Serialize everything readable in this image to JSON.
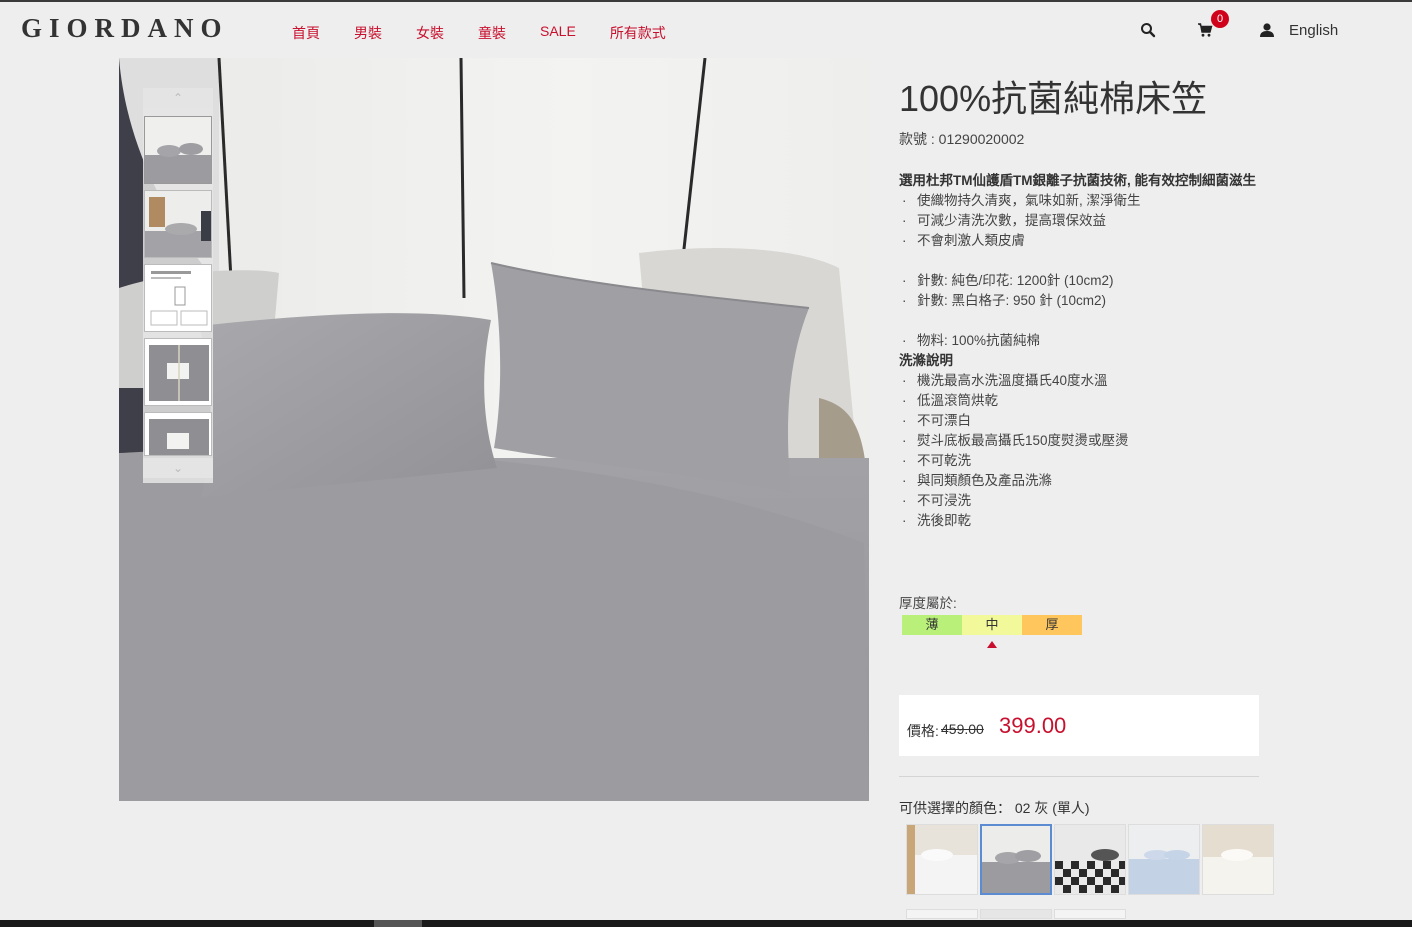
{
  "header": {
    "logo": "GIORDANO",
    "nav": [
      "首頁",
      "男裝",
      "女裝",
      "童裝",
      "SALE",
      "所有款式"
    ],
    "cart_count": "0",
    "language": "English"
  },
  "product": {
    "title": "100%抗菌純棉床笠",
    "sku": "款號 : 01290020002",
    "intro": "選用杜邦TM仙護盾TM銀離子抗菌技術, 能有效控制細菌滋生",
    "features": [
      "使織物持久清爽，氣味如新, 潔淨衛生",
      "可減少清洗次數，提高環保效益",
      "不會刺激人類皮膚"
    ],
    "thread_counts": [
      "針數: 純色/印花: 1200針 (10cm2)",
      "針數: 黑白格子: 950 針 (10cm2)"
    ],
    "material": "物料: 100%抗菌純棉",
    "wash_title": "洗滌說明",
    "wash": [
      "機洗最高水洗溫度攝氏40度水溫",
      "低溫滾筒烘乾",
      "不可漂白",
      "熨斗底板最高攝氏150度熨燙或壓燙",
      "不可乾洗",
      "與同類顏色及產品洗滌",
      "不可浸洗",
      "洗後即乾"
    ],
    "thickness_label": "厚度屬於:",
    "thickness_levels": [
      "薄",
      "中",
      "厚"
    ],
    "thickness_selected": "中",
    "price_label": "價格:",
    "price_old": "459.00",
    "price_new": "399.00",
    "color_label": "可供選擇的顏色： 02 灰 (單人)"
  },
  "colors": {
    "accent": "#c8102e",
    "thin": "#b8f07a",
    "medium": "#f1f99a",
    "thick": "#ffc65e",
    "sheet_gray": "#9a9a9e"
  },
  "icons": {
    "search": "search-icon",
    "cart": "cart-icon",
    "user": "user-icon",
    "up": "chevron-up-icon",
    "down": "chevron-down-icon"
  }
}
